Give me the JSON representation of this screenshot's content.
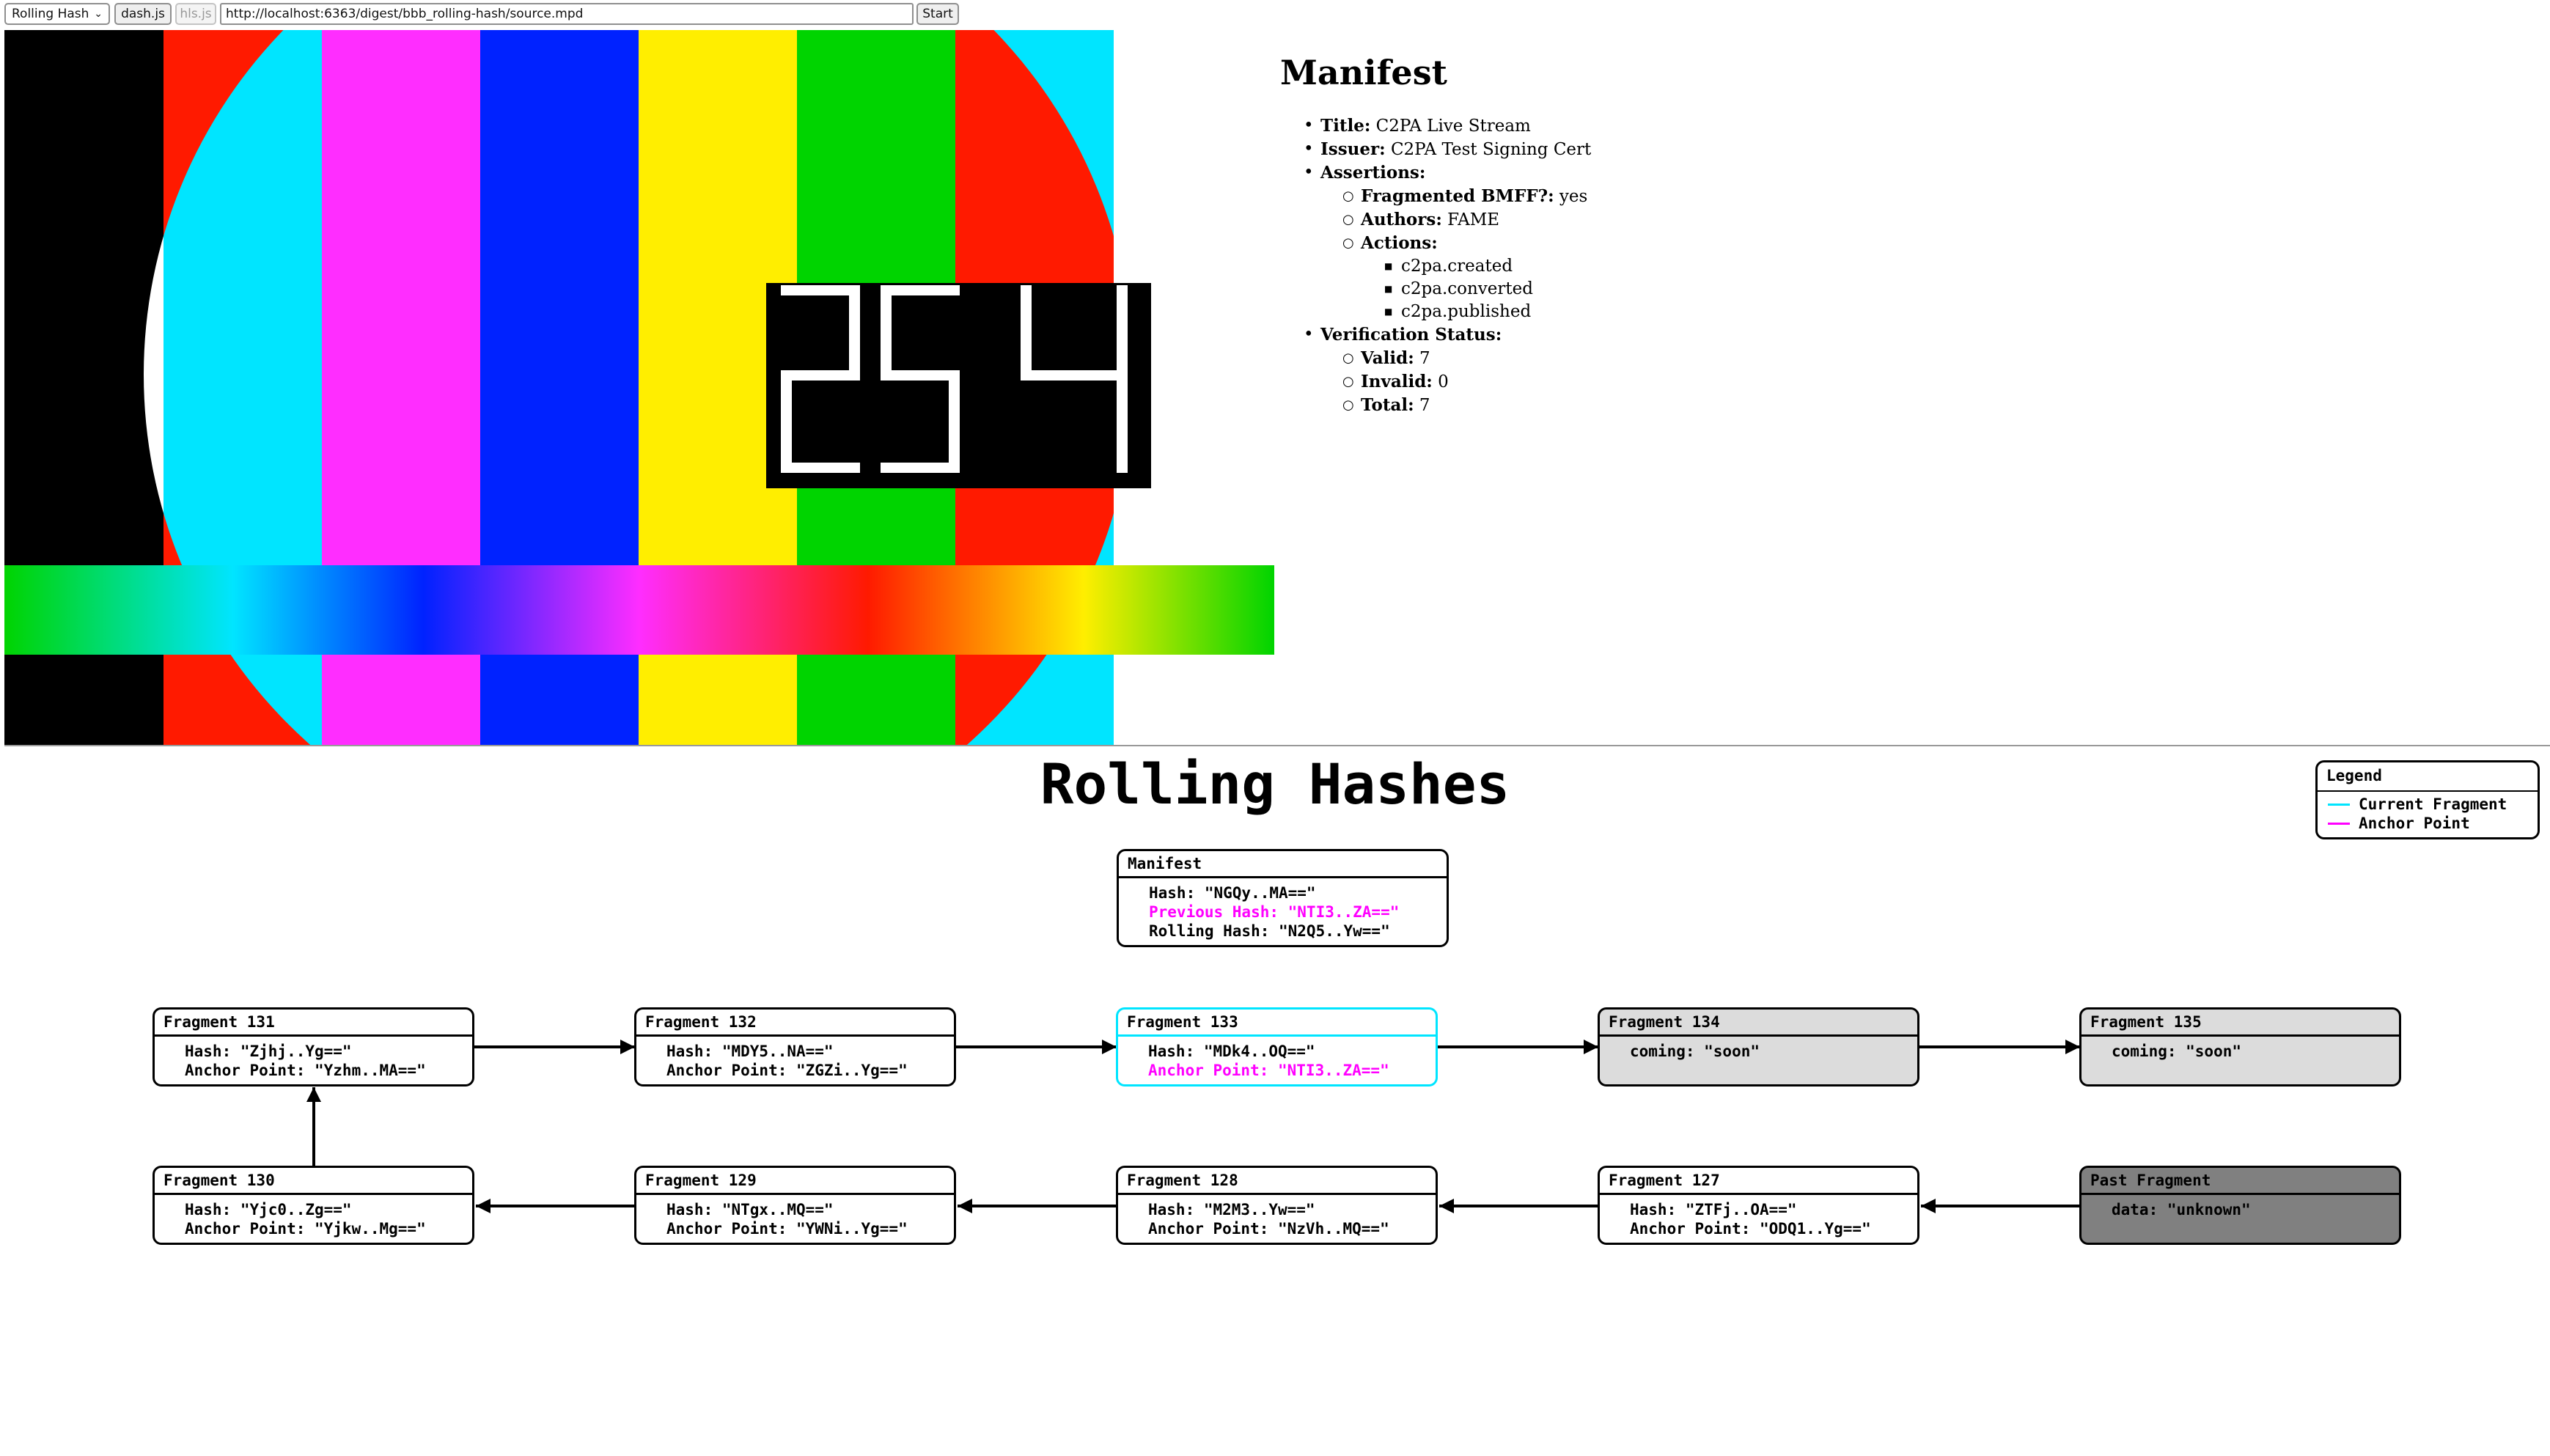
{
  "toolbar": {
    "mode_select": "Rolling Hash",
    "dashjs_label": "dash.js",
    "hlsjs_label": "hls.js",
    "url": "http://localhost:6363/digest/bbb_rolling-hash/source.mpd",
    "start_label": "Start"
  },
  "video": {
    "overlay_number": "25",
    "bar_colors": [
      "#000000",
      "#00e5ff",
      "#ff2dff",
      "#0022ff",
      "#ffee00",
      "#00d400",
      "#ff1a00"
    ]
  },
  "manifest": {
    "heading": "Manifest",
    "title_label": "Title:",
    "title_value": "C2PA Live Stream",
    "issuer_label": "Issuer:",
    "issuer_value": "C2PA Test Signing Cert",
    "assertions_label": "Assertions:",
    "bmff_label": "Fragmented BMFF?:",
    "bmff_value": "yes",
    "authors_label": "Authors:",
    "authors_value": "FAME",
    "actions_label": "Actions:",
    "actions": [
      "c2pa.created",
      "c2pa.converted",
      "c2pa.published"
    ],
    "verification_label": "Verification Status:",
    "valid_label": "Valid:",
    "valid_value": "7",
    "invalid_label": "Invalid:",
    "invalid_value": "0",
    "total_label": "Total:",
    "total_value": "7"
  },
  "rolling": {
    "title": "Rolling Hashes",
    "legend": {
      "title": "Legend",
      "current": "Current Fragment",
      "current_color": "#00e5ff",
      "anchor": "Anchor Point",
      "anchor_color": "#ff00ff"
    },
    "manifest_node": {
      "title": "Manifest",
      "hash": "Hash: \"NGQy..MA==\"",
      "previous": "Previous Hash: \"NTI3..ZA==\"",
      "rolling": "Rolling Hash: \"N2Q5..Yw==\""
    },
    "fragments": {
      "f131": {
        "title": "Fragment 131",
        "l1": "Hash: \"Zjhj..Yg==\"",
        "l2": "Anchor Point: \"Yzhm..MA==\""
      },
      "f132": {
        "title": "Fragment 132",
        "l1": "Hash: \"MDY5..NA==\"",
        "l2": "Anchor Point: \"ZGZi..Yg==\""
      },
      "f133": {
        "title": "Fragment 133",
        "l1": "Hash: \"MDk4..OQ==\"",
        "l2": "Anchor Point: \"NTI3..ZA==\""
      },
      "f134": {
        "title": "Fragment 134",
        "l1": "coming: \"soon\""
      },
      "f135": {
        "title": "Fragment 135",
        "l1": "coming: \"soon\""
      },
      "f130": {
        "title": "Fragment 130",
        "l1": "Hash: \"Yjc0..Zg==\"",
        "l2": "Anchor Point: \"Yjkw..Mg==\""
      },
      "f129": {
        "title": "Fragment 129",
        "l1": "Hash: \"NTgx..MQ==\"",
        "l2": "Anchor Point: \"YWNi..Yg==\""
      },
      "f128": {
        "title": "Fragment 128",
        "l1": "Hash: \"M2M3..Yw==\"",
        "l2": "Anchor Point: \"NzVh..MQ==\""
      },
      "f127": {
        "title": "Fragment 127",
        "l1": "Hash: \"ZTFj..OA==\"",
        "l2": "Anchor Point: \"ODQ1..Yg==\""
      },
      "past": {
        "title": "Past Fragment",
        "l1": "data: \"unknown\""
      }
    }
  }
}
